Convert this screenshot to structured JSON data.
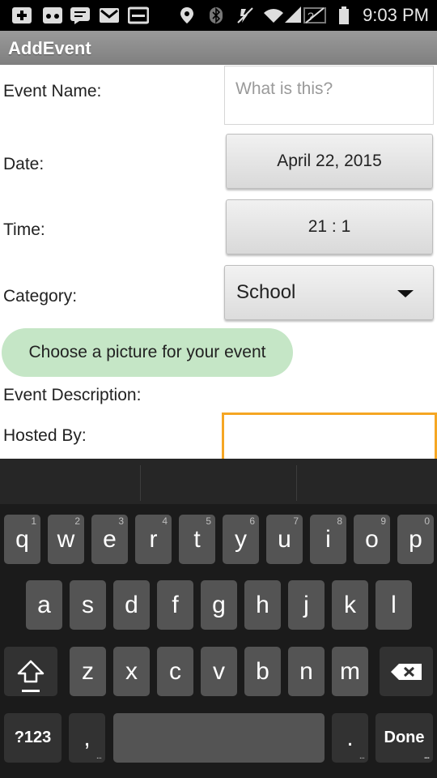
{
  "status_bar": {
    "time": "9:03 PM",
    "icons": [
      "add-icon",
      "voicemail-icon",
      "message-icon",
      "gmail-icon",
      "email-icon",
      "location-icon",
      "bluetooth-icon",
      "mute-icon",
      "wifi-icon",
      "signal-icon",
      "battery-icon"
    ]
  },
  "app": {
    "title": "AddEvent"
  },
  "form": {
    "event_name_label": "Event Name:",
    "event_name_placeholder": "What is this?",
    "date_label": "Date:",
    "date_value": "April 22, 2015",
    "time_label": "Time:",
    "time_value": "21 : 1",
    "category_label": "Category:",
    "category_value": "School",
    "picture_button": "Choose a picture for your event",
    "description_label": "Event Description:",
    "hosted_label": "Hosted By:"
  },
  "keyboard": {
    "row1": [
      {
        "k": "q",
        "n": "1"
      },
      {
        "k": "w",
        "n": "2"
      },
      {
        "k": "e",
        "n": "3"
      },
      {
        "k": "r",
        "n": "4"
      },
      {
        "k": "t",
        "n": "5"
      },
      {
        "k": "y",
        "n": "6"
      },
      {
        "k": "u",
        "n": "7"
      },
      {
        "k": "i",
        "n": "8"
      },
      {
        "k": "o",
        "n": "9"
      },
      {
        "k": "p",
        "n": "0"
      }
    ],
    "row2": [
      "a",
      "s",
      "d",
      "f",
      "g",
      "h",
      "j",
      "k",
      "l"
    ],
    "row3": [
      "z",
      "x",
      "c",
      "v",
      "b",
      "n",
      "m"
    ],
    "symbols_label": "?123",
    "comma_label": ",",
    "period_label": ".",
    "done_label": "Done",
    "more_dots": "..."
  },
  "colors": {
    "accent_focus": "#f5a623",
    "picture_button_bg": "#c5e6c6"
  }
}
